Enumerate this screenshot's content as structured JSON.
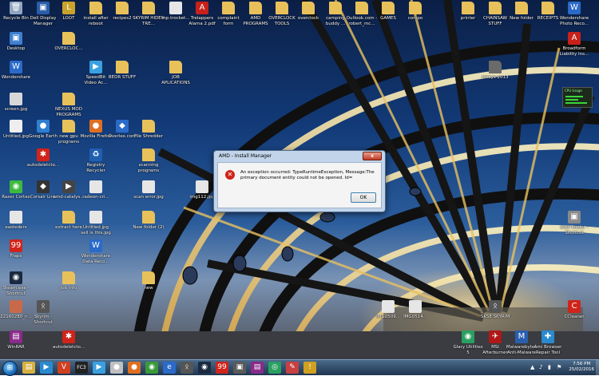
{
  "desktop_icons": [
    {
      "label": "Recycle Bin",
      "icon": "recycle-bin-icon",
      "glyph": "🗑",
      "color": "#8fa6c0",
      "col": 0,
      "row": 0
    },
    {
      "label": "Dell Display Manager",
      "icon": "dell-display-icon",
      "glyph": "▣",
      "color": "#2a5da8",
      "col": 1,
      "row": 0
    },
    {
      "label": "LOOT",
      "icon": "loot-icon",
      "glyph": "L",
      "color": "#c9a32a",
      "col": 2,
      "row": 0
    },
    {
      "label": "install after reboot",
      "icon": "folder-icon",
      "glyph": "",
      "color": "#e8c15a",
      "col": 3,
      "row": 0
    },
    {
      "label": "recipes2",
      "icon": "folder-icon",
      "glyph": "",
      "color": "#e8c15a",
      "col": 4,
      "row": 0
    },
    {
      "label": "SKYRIM HIDEN TRE...",
      "icon": "folder-icon",
      "glyph": "",
      "color": "#e8c15a",
      "col": 5,
      "row": 0
    },
    {
      "label": "mp.trocket...",
      "icon": "file-icon",
      "glyph": "",
      "color": "#e6e6e6",
      "col": 6,
      "row": 0
    },
    {
      "label": "Trelappers Alama 2.pdf",
      "icon": "pdf-icon",
      "glyph": "A",
      "color": "#c8201a",
      "col": 7,
      "row": 0
    },
    {
      "label": "complaint form",
      "icon": "folder-icon",
      "glyph": "",
      "color": "#e8c15a",
      "col": 8,
      "row": 0
    },
    {
      "label": "AMD PROGRAMS",
      "icon": "folder-icon",
      "glyph": "",
      "color": "#e8c15a",
      "col": 9,
      "row": 0
    },
    {
      "label": "OVERCLOCK TOOLS",
      "icon": "folder-icon",
      "glyph": "",
      "color": "#e8c15a",
      "col": 10,
      "row": 0
    },
    {
      "label": "overclock",
      "icon": "folder-icon",
      "glyph": "",
      "color": "#e8c15a",
      "col": 11,
      "row": 0
    },
    {
      "label": "camping buddy ...",
      "icon": "folder-icon",
      "glyph": "",
      "color": "#e8c15a",
      "col": 12,
      "row": 0
    },
    {
      "label": "Outlook.com - robert_mc...",
      "icon": "folder-icon",
      "glyph": "",
      "color": "#e8c15a",
      "col": 13,
      "row": 0
    },
    {
      "label": "GAMES",
      "icon": "folder-icon",
      "glyph": "",
      "color": "#e8c15a",
      "col": 14,
      "row": 0
    },
    {
      "label": "compo",
      "icon": "folder-icon",
      "glyph": "",
      "color": "#e8c15a",
      "col": 15,
      "row": 0
    },
    {
      "label": "printer",
      "icon": "folder-icon",
      "glyph": "",
      "color": "#e8c15a",
      "col": 17,
      "row": 0
    },
    {
      "label": "CHAINSAW STUFF",
      "icon": "folder-icon",
      "glyph": "",
      "color": "#e8c15a",
      "col": 18,
      "row": 0
    },
    {
      "label": "New folder",
      "icon": "folder-icon",
      "glyph": "",
      "color": "#e8c15a",
      "col": 19,
      "row": 0
    },
    {
      "label": "RECEIPTS",
      "icon": "folder-icon",
      "glyph": "",
      "color": "#e8c15a",
      "col": 20,
      "row": 0
    },
    {
      "label": "Wondershare Photo Reco...",
      "icon": "wondershare-icon",
      "glyph": "W",
      "color": "#2a6ac8",
      "col": 21,
      "row": 0
    },
    {
      "label": "Desktop",
      "icon": "desktop-icon",
      "glyph": "▣",
      "color": "#3f7fd0",
      "col": 0,
      "row": 1
    },
    {
      "label": "OVERCLOC...",
      "icon": "folder-icon",
      "glyph": "",
      "color": "#e8c15a",
      "col": 2,
      "row": 1
    },
    {
      "label": "Broadform Liability Ins...",
      "icon": "pdf-icon",
      "glyph": "A",
      "color": "#c8201a",
      "col": 21,
      "row": 1
    },
    {
      "label": "Wondershare",
      "icon": "wondershare-icon",
      "glyph": "W",
      "color": "#2a6ac8",
      "col": 0,
      "row": 2
    },
    {
      "label": "SpeedBit Video Ac...",
      "icon": "speedbit-icon",
      "glyph": "▶",
      "color": "#3aa0e0",
      "col": 3,
      "row": 2
    },
    {
      "label": "BEDR STUFF",
      "icon": "folder-icon",
      "glyph": "",
      "color": "#e8c15a",
      "col": 4,
      "row": 2
    },
    {
      "label": "JOB APLICATIONS",
      "icon": "folder-icon",
      "glyph": "",
      "color": "#e8c15a",
      "col": 6,
      "row": 2
    },
    {
      "label": "piccys 2013",
      "icon": "folder-icon",
      "glyph": "",
      "color": "#6a6a6a",
      "col": 18,
      "row": 2
    },
    {
      "label": "screen.jpg",
      "icon": "image-icon",
      "glyph": "",
      "color": "#d8d8d8",
      "col": 0,
      "row": 3
    },
    {
      "label": "NEXUS MOD PROGRAMS",
      "icon": "folder-icon",
      "glyph": "",
      "color": "#e8c15a",
      "col": 2,
      "row": 3
    },
    {
      "label": "Untitled.jpg",
      "icon": "image-icon",
      "glyph": "",
      "color": "#eeeeee",
      "col": 0,
      "row": 4
    },
    {
      "label": "Google Earth",
      "icon": "google-earth-icon",
      "glyph": "●",
      "color": "#2f7fd0",
      "col": 1,
      "row": 4
    },
    {
      "label": "new gpu programs",
      "icon": "folder-icon",
      "glyph": "",
      "color": "#e8c15a",
      "col": 2,
      "row": 4
    },
    {
      "label": "Mozilla Firefox",
      "icon": "firefox-icon",
      "glyph": "●",
      "color": "#e07020",
      "col": 3,
      "row": 4
    },
    {
      "label": "Overlex.com",
      "icon": "overlex-icon",
      "glyph": "◆",
      "color": "#2a6ac8",
      "col": 4,
      "row": 4
    },
    {
      "label": "File Shredder",
      "icon": "folder-icon",
      "glyph": "",
      "color": "#e8c15a",
      "col": 5,
      "row": 4
    },
    {
      "label": "autodeletcto...",
      "icon": "autodelete-icon",
      "glyph": "✱",
      "color": "#d0241a",
      "col": 1,
      "row": 5
    },
    {
      "label": "Registry Recycler",
      "icon": "registry-recycler-icon",
      "glyph": "♻",
      "color": "#1f5fb0",
      "col": 3,
      "row": 5
    },
    {
      "label": "scanning programs",
      "icon": "folder-icon",
      "glyph": "",
      "color": "#e8c15a",
      "col": 5,
      "row": 5
    },
    {
      "label": "Razer Cortex",
      "icon": "razer-icon",
      "glyph": "◉",
      "color": "#3dba3d",
      "col": 0,
      "row": 6
    },
    {
      "label": "Corsair Link",
      "icon": "corsair-icon",
      "glyph": "◆",
      "color": "#333333",
      "col": 1,
      "row": 6
    },
    {
      "label": "amd-catalys...",
      "icon": "amd-icon",
      "glyph": "▶",
      "color": "#444444",
      "col": 2,
      "row": 6
    },
    {
      "label": "radeon-cri...",
      "icon": "file-icon",
      "glyph": "",
      "color": "#e6e6e6",
      "col": 3,
      "row": 6
    },
    {
      "label": "scan error.jpg",
      "icon": "image-icon",
      "glyph": "",
      "color": "#e6e6e6",
      "col": 5,
      "row": 6
    },
    {
      "label": "img112.jpg",
      "icon": "image-icon",
      "glyph": "",
      "color": "#e6e6e6",
      "col": 7,
      "row": 6
    },
    {
      "label": "easteders",
      "icon": "file-icon",
      "glyph": "",
      "color": "#e6e6e6",
      "col": 0,
      "row": 7
    },
    {
      "label": "extract here",
      "icon": "folder-icon",
      "glyph": "",
      "color": "#e8c15a",
      "col": 2,
      "row": 7
    },
    {
      "label": "Untitled.jpg sell is this.jpg",
      "icon": "image-icon",
      "glyph": "",
      "color": "#e6e6e6",
      "col": 3,
      "row": 7
    },
    {
      "label": "New folder (2)",
      "icon": "folder-icon",
      "glyph": "",
      "color": "#e8c15a",
      "col": 5,
      "row": 7
    },
    {
      "label": "skse loader - Shortcut",
      "icon": "skse-icon",
      "glyph": "▣",
      "color": "#8a8a8a",
      "col": 21,
      "row": 7
    },
    {
      "label": "Fraps",
      "icon": "fraps-icon",
      "glyph": "99",
      "color": "#d0241a",
      "col": 0,
      "row": 8
    },
    {
      "label": "Wondershare Data Reco...",
      "icon": "wondershare-icon",
      "glyph": "W",
      "color": "#2a6ac8",
      "col": 3,
      "row": 8
    },
    {
      "label": "Steam.exe - Shortcut",
      "icon": "steam-icon",
      "glyph": "◉",
      "color": "#1a2a40",
      "col": 0,
      "row": 9
    },
    {
      "label": "job info",
      "icon": "folder-icon",
      "glyph": "",
      "color": "#e8c15a",
      "col": 2,
      "row": 9
    },
    {
      "label": "new",
      "icon": "folder-icon",
      "glyph": "",
      "color": "#e8c15a",
      "col": 5,
      "row": 9
    },
    {
      "label": "22160280_n...",
      "icon": "image-icon",
      "glyph": "",
      "color": "#c86a4a",
      "col": 0,
      "row": 10
    },
    {
      "label": "Skyrim - Shortcut",
      "icon": "skyrim-icon",
      "glyph": "ᛟ",
      "color": "#555555",
      "col": 1,
      "row": 10
    },
    {
      "label": "IMG0509...",
      "icon": "image-icon",
      "glyph": "",
      "color": "#e6e6e6",
      "col": 14,
      "row": 10
    },
    {
      "label": "IMG0514...",
      "icon": "image-icon",
      "glyph": "",
      "color": "#e6e6e6",
      "col": 15,
      "row": 10
    },
    {
      "label": "SKSE SKYRIM",
      "icon": "skyrim-icon",
      "glyph": "ᛟ",
      "color": "#555555",
      "col": 18,
      "row": 10
    },
    {
      "label": "CCleaner",
      "icon": "ccleaner-icon",
      "glyph": "C",
      "color": "#d0241a",
      "col": 21,
      "row": 10
    },
    {
      "label": "WinRAR",
      "icon": "winrar-icon",
      "glyph": "▤",
      "color": "#8a2a8a",
      "col": 0,
      "row": 11
    },
    {
      "label": "autodeletcto...",
      "icon": "autodelete-icon",
      "glyph": "✱",
      "color": "#d0241a",
      "col": 2,
      "row": 11
    },
    {
      "label": "Glary Utilities 5",
      "icon": "glary-icon",
      "glyph": "◉",
      "color": "#2aa060",
      "col": 17,
      "row": 11
    },
    {
      "label": "MSI Afterburner",
      "icon": "msi-icon",
      "glyph": "✈",
      "color": "#b01818",
      "col": 18,
      "row": 11
    },
    {
      "label": "Malwarebytes Anti-Malware",
      "icon": "malwarebytes-icon",
      "glyph": "M",
      "color": "#2a5fb0",
      "col": 19,
      "row": 11
    },
    {
      "label": "Ami Browser Repair Tool",
      "icon": "repair-icon",
      "glyph": "✚",
      "color": "#2a8ad0",
      "col": 20,
      "row": 11
    }
  ],
  "dialog": {
    "title": "AMD - Install Manager",
    "message": "An exception occurred: TypeRuntimeException, Message:The primary document entity could not be opened. Id=",
    "ok_label": "OK",
    "close_label": "x"
  },
  "gadget": {
    "title": "CPU Usage"
  },
  "taskbar": {
    "start_glyph": "⊞",
    "items": [
      {
        "name": "explorer-taskbar-icon",
        "glyph": "▤",
        "color": "#d8b040"
      },
      {
        "name": "media-player-taskbar-icon",
        "glyph": "▶",
        "color": "#2a8ad0"
      },
      {
        "name": "vivaldi-taskbar-icon",
        "glyph": "V",
        "color": "#d04020"
      },
      {
        "name": "fc3-taskbar-icon",
        "glyph": "FC3",
        "color": "#222222"
      },
      {
        "name": "speedbit-taskbar-icon",
        "glyph": "▶",
        "color": "#3aa0e0"
      },
      {
        "name": "circle-taskbar-icon",
        "glyph": "●",
        "color": "#c0c0c0"
      },
      {
        "name": "firefox-taskbar-icon",
        "glyph": "●",
        "color": "#e07020"
      },
      {
        "name": "chrome-taskbar-icon",
        "glyph": "◉",
        "color": "#3a9a3a"
      },
      {
        "name": "ie-taskbar-icon",
        "glyph": "e",
        "color": "#2a6ac8"
      },
      {
        "name": "skyrim-taskbar-icon",
        "glyph": "ᛟ",
        "color": "#555555"
      },
      {
        "name": "steam-taskbar-icon",
        "glyph": "◉",
        "color": "#1a2a40"
      },
      {
        "name": "fraps-taskbar-icon",
        "glyph": "99",
        "color": "#d0241a"
      },
      {
        "name": "apps-taskbar-icon",
        "glyph": "▣",
        "color": "#5a5a5a"
      },
      {
        "name": "winrar-taskbar-icon",
        "glyph": "▤",
        "color": "#8a2a8a"
      },
      {
        "name": "network-taskbar-icon",
        "glyph": "◎",
        "color": "#2aa060"
      },
      {
        "name": "paint-taskbar-icon",
        "glyph": "✎",
        "color": "#c84040"
      },
      {
        "name": "alert-taskbar-icon",
        "glyph": "!",
        "color": "#d0a020"
      }
    ],
    "tray": [
      {
        "name": "tray-arrow-icon",
        "glyph": "▲"
      },
      {
        "name": "tray-volume-icon",
        "glyph": "♪"
      },
      {
        "name": "tray-network-icon",
        "glyph": "▮"
      },
      {
        "name": "tray-flag-icon",
        "glyph": "⚑"
      }
    ],
    "time": "7:56 PM",
    "date": "25/02/2016"
  }
}
